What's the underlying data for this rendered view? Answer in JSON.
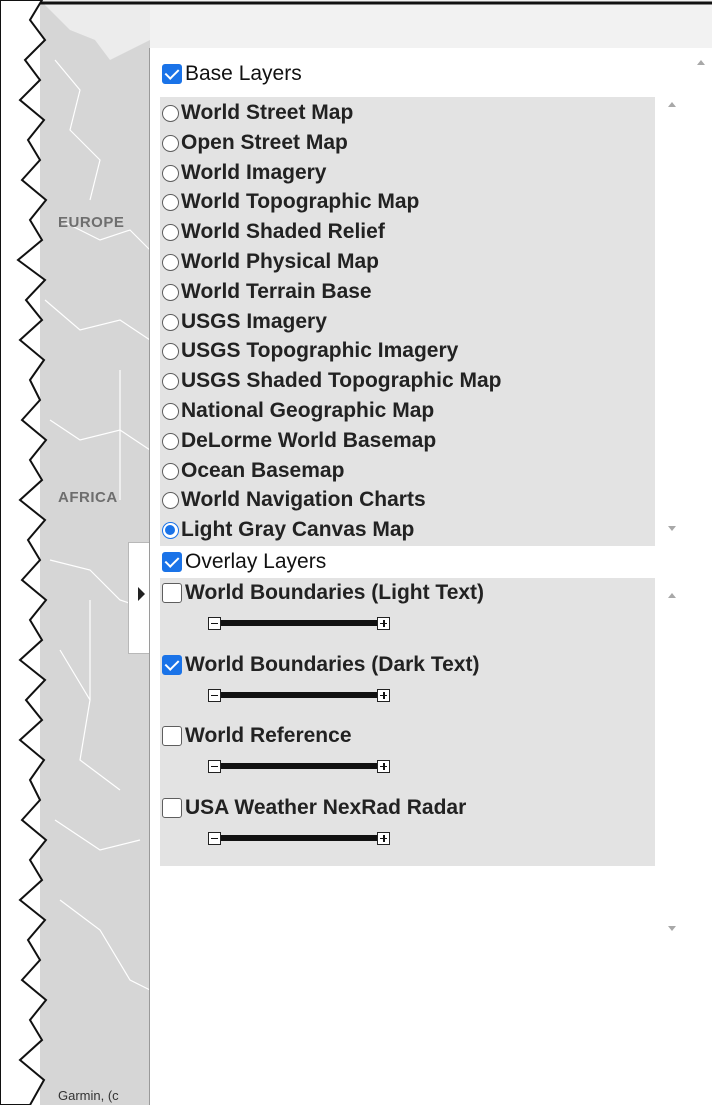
{
  "map": {
    "labels": {
      "europe": "EUROPE",
      "africa": "AFRICA"
    },
    "attribution": "Garmin, (c"
  },
  "layer_list": {
    "base": {
      "title": "Base Layers",
      "checked": true,
      "layers": [
        {
          "label": "World Street Map",
          "selected": false
        },
        {
          "label": "Open Street Map",
          "selected": false
        },
        {
          "label": "World Imagery",
          "selected": false
        },
        {
          "label": "World Topographic Map",
          "selected": false
        },
        {
          "label": "World Shaded Relief",
          "selected": false
        },
        {
          "label": "World Physical Map",
          "selected": false
        },
        {
          "label": "World Terrain Base",
          "selected": false
        },
        {
          "label": "USGS Imagery",
          "selected": false
        },
        {
          "label": "USGS Topographic Imagery",
          "selected": false
        },
        {
          "label": "USGS Shaded Topographic Map",
          "selected": false
        },
        {
          "label": "National Geographic Map",
          "selected": false
        },
        {
          "label": "DeLorme World Basemap",
          "selected": false
        },
        {
          "label": "Ocean Basemap",
          "selected": false
        },
        {
          "label": "World Navigation Charts",
          "selected": false
        },
        {
          "label": "Light Gray Canvas Map",
          "selected": true
        }
      ]
    },
    "overlay": {
      "title": "Overlay Layers",
      "checked": true,
      "layers": [
        {
          "label": "World Boundaries (Light Text)",
          "checked": false,
          "opacity": 1.0
        },
        {
          "label": "World Boundaries (Dark Text)",
          "checked": true,
          "opacity": 1.0
        },
        {
          "label": "World Reference",
          "checked": false,
          "opacity": 1.0
        },
        {
          "label": "USA Weather NexRad Radar",
          "checked": false,
          "opacity": 1.0
        }
      ]
    }
  },
  "colors": {
    "accent": "#1a73e8",
    "group_background": "#e3e3e3",
    "map_land": "#d2d2d2",
    "map_water": "#f0f0f0"
  }
}
